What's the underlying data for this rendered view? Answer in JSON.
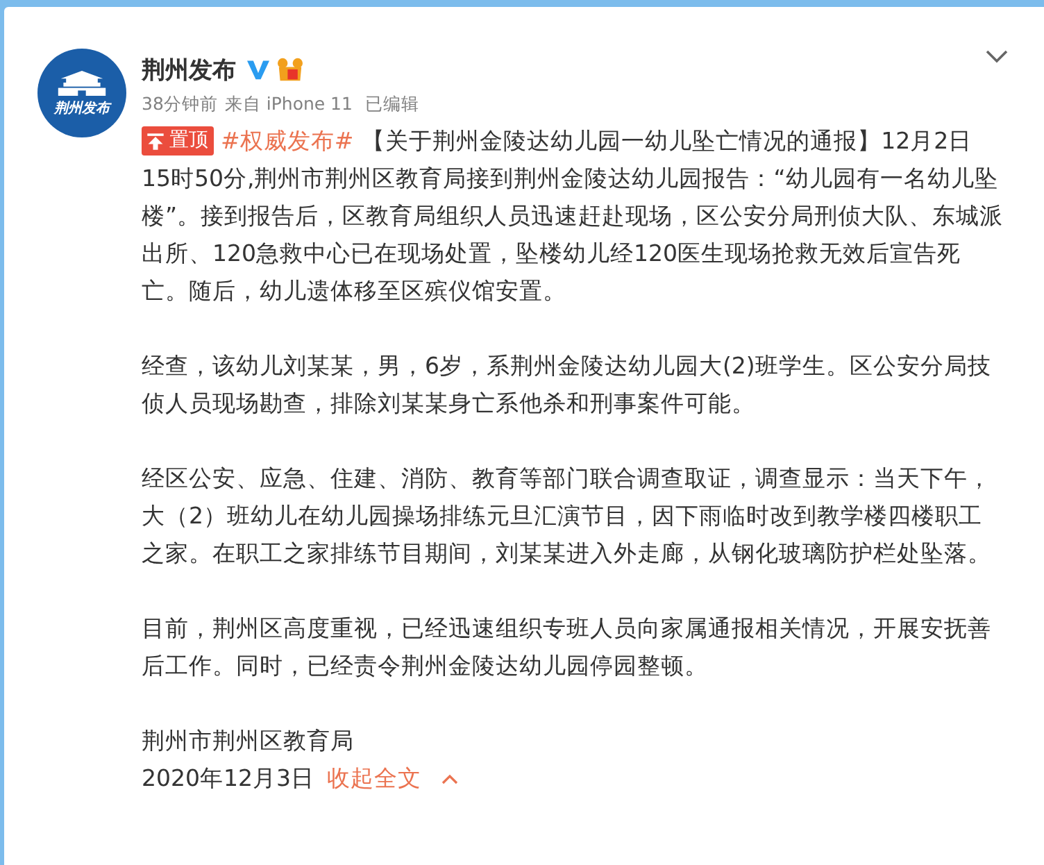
{
  "author": {
    "name": "荆州发布",
    "avatar_text": "荆州发布",
    "verified": true,
    "time": "38分钟前",
    "source": "来自 iPhone 11",
    "edited": "已编辑"
  },
  "post": {
    "pin_label": "置顶",
    "topic": "#权威发布#",
    "headline": "【关于荆州金陵达幼儿园一幼儿坠亡情况的通报】12月2日",
    "paragraphs": [
      "15时50分,荆州市荆州区教育局接到荆州金陵达幼儿园报告：“幼儿园有一名幼儿坠楼”。接到报告后，区教育局组织人员迅速赶赴现场，区公安分局刑侦大队、东城派出所、120急救中心已在现场处置，坠楼幼儿经120医生现场抢救无效后宣告死亡。随后，幼儿遗体移至区殡仪馆安置。",
      "经查，该幼儿刘某某，男，6岁，系荆州金陵达幼儿园大(2)班学生。区公安分局技侦人员现场勘查，排除刘某某身亡系他杀和刑事案件可能。",
      "经区公安、应急、住建、消防、教育等部门联合调查取证，调查显示：当天下午，大（2）班幼儿在幼儿园操场排练元旦汇演节目，因下雨临时改到教学楼四楼职工之家。在职工之家排练节目期间，刘某某进入外走廊，从钢化玻璃防护栏处坠落。",
      "目前，荆州区高度重视，已经迅速组织专班人员向家属通报相关情况，开展安抚善后工作。同时，已经责令荆州金陵达幼儿园停园整顿。",
      "荆州市荆州区教育局"
    ],
    "date": "2020年12月3日",
    "collapse_link": "收起全文"
  }
}
